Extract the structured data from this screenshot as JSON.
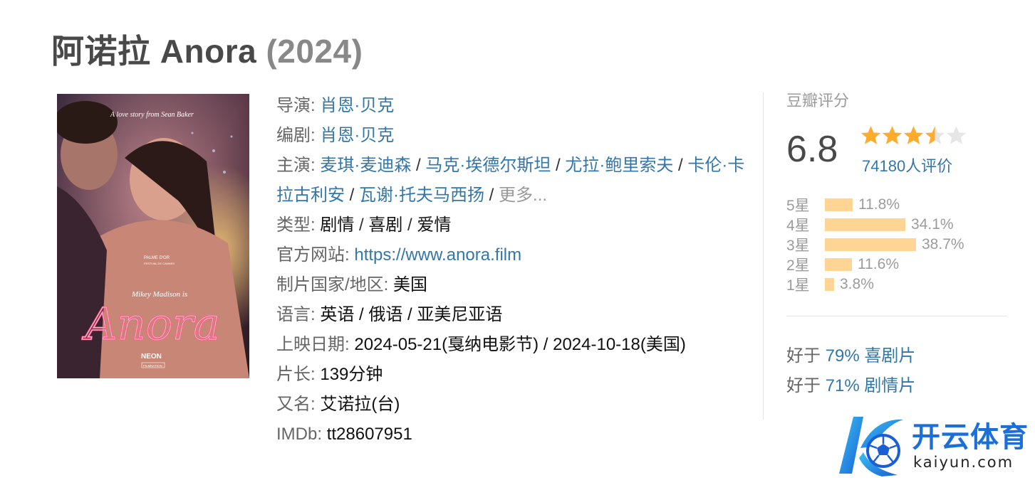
{
  "header": {
    "title": "阿诺拉 Anora",
    "year": "(2024)"
  },
  "poster": {
    "tagline": "A love story from Sean Baker",
    "festival": "PALME D'OR",
    "festival_sub": "FESTIVAL DE CANNES",
    "actor_line": "Mikey Madison is",
    "neon_title": "Anora",
    "studio": "NEON",
    "studio2": "FILMNATION"
  },
  "info": {
    "director_label": "导演",
    "director": "肖恩·贝克",
    "writer_label": "编剧",
    "writer": "肖恩·贝克",
    "cast_label": "主演",
    "cast": [
      "麦琪·麦迪森",
      "马克·埃德尔斯坦",
      "尤拉·鲍里索夫",
      "卡伦·卡拉古利安",
      "瓦谢·托夫马西扬"
    ],
    "cast_more": "更多...",
    "genre_label": "类型",
    "genres": [
      "剧情",
      "喜剧",
      "爱情"
    ],
    "website_label": "官方网站",
    "website": "https://www.anora.film",
    "country_label": "制片国家/地区",
    "country": "美国",
    "language_label": "语言",
    "languages": "英语 / 俄语 / 亚美尼亚语",
    "release_label": "上映日期",
    "release": "2024-05-21(戛纳电影节) / 2024-10-18(美国)",
    "runtime_label": "片长",
    "runtime": "139分钟",
    "aka_label": "又名",
    "aka": "艾诺拉(台)",
    "imdb_label": "IMDb",
    "imdb": "tt28607951"
  },
  "rating": {
    "label": "豆瓣评分",
    "score": "6.8",
    "stars": 3.5,
    "votes": "74180人评价",
    "star_color": "#ffac2d",
    "distribution": [
      {
        "label": "5星",
        "percent": "11.8%",
        "value": 11.8
      },
      {
        "label": "4星",
        "percent": "34.1%",
        "value": 34.1
      },
      {
        "label": "3星",
        "percent": "38.7%",
        "value": 38.7
      },
      {
        "label": "2星",
        "percent": "11.6%",
        "value": 11.6
      },
      {
        "label": "1星",
        "percent": "3.8%",
        "value": 3.8
      }
    ],
    "better_than": [
      {
        "prefix": "好于",
        "text": "79% 喜剧片"
      },
      {
        "prefix": "好于",
        "text": "71% 剧情片"
      }
    ]
  },
  "watermark": {
    "name": "开云体育",
    "domain": "kaiyun.com"
  }
}
